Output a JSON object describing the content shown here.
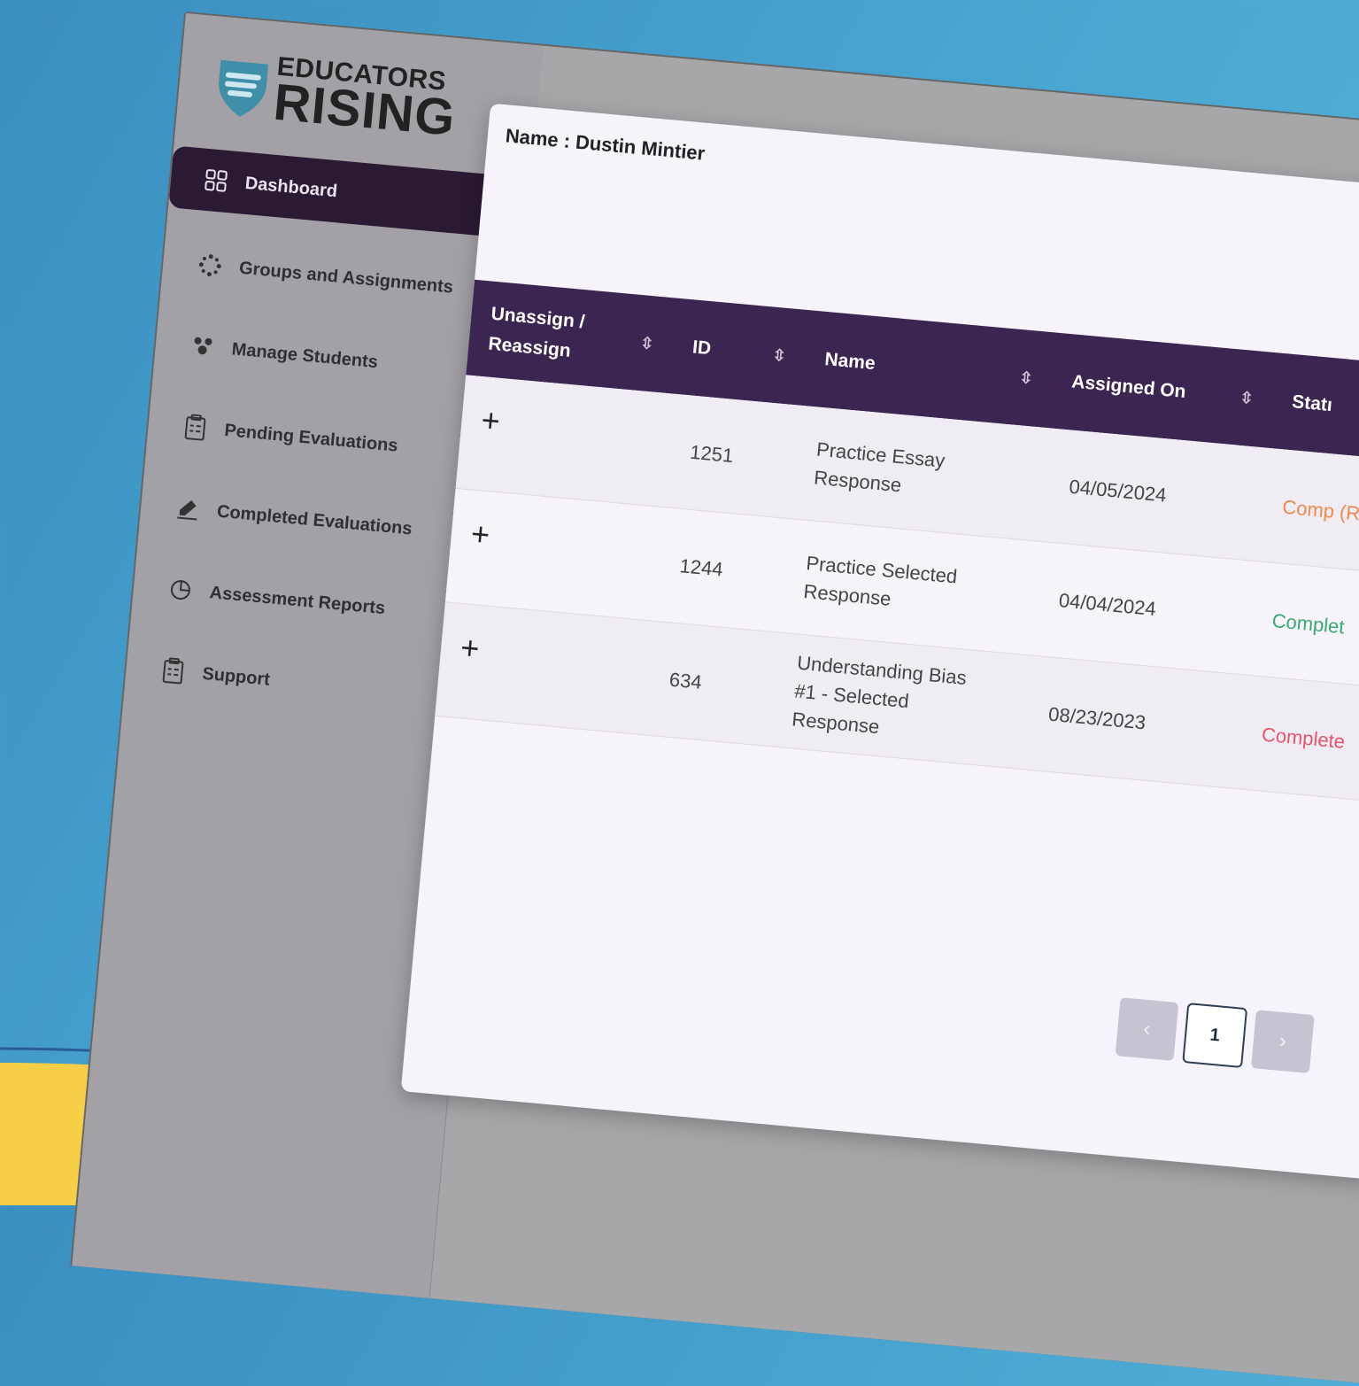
{
  "brand": {
    "line1": "EDUCATORS",
    "line2": "RISING"
  },
  "sidebar": {
    "items": [
      {
        "label": "Dashboard",
        "icon": "grid-icon",
        "active": true
      },
      {
        "label": "Groups and Assignments",
        "icon": "spinner-icon"
      },
      {
        "label": "Manage Students",
        "icon": "users-icon"
      },
      {
        "label": "Pending Evaluations",
        "icon": "clipboard-icon"
      },
      {
        "label": "Completed Evaluations",
        "icon": "pencil-icon"
      },
      {
        "label": "Assessment Reports",
        "icon": "pie-chart-icon"
      },
      {
        "label": "Support",
        "icon": "clipboard-icon"
      }
    ]
  },
  "modal": {
    "name_label": "Name : Dustin Mintier",
    "columns": [
      "Unassign / Reassign",
      "ID",
      "Name",
      "Assigned On",
      "Statı"
    ],
    "rows": [
      {
        "action": "+",
        "id": "1251",
        "name": "Practice Essay Response",
        "assigned_on": "04/05/2024",
        "status": "Comp (Review Pending)"
      },
      {
        "action": "+",
        "id": "1244",
        "name": "Practice Selected Response",
        "assigned_on": "04/04/2024",
        "status": "Complet"
      },
      {
        "action": "+",
        "id": "634",
        "name": "Understanding Bias #1 - Selected Response",
        "assigned_on": "08/23/2023",
        "status": "Complete"
      }
    ],
    "status_colors": {
      "pending": "#f0894a",
      "complete": "#3aa96f",
      "late": "#e5566a"
    },
    "pagination": {
      "prev": "‹",
      "current": "1",
      "next": "›"
    }
  },
  "colors": {
    "header_bg": "#3b2651",
    "active_nav_bg": "#2a1a33",
    "wave_yellow": "#f7cf47",
    "wave_line": "#2c5a9b"
  }
}
